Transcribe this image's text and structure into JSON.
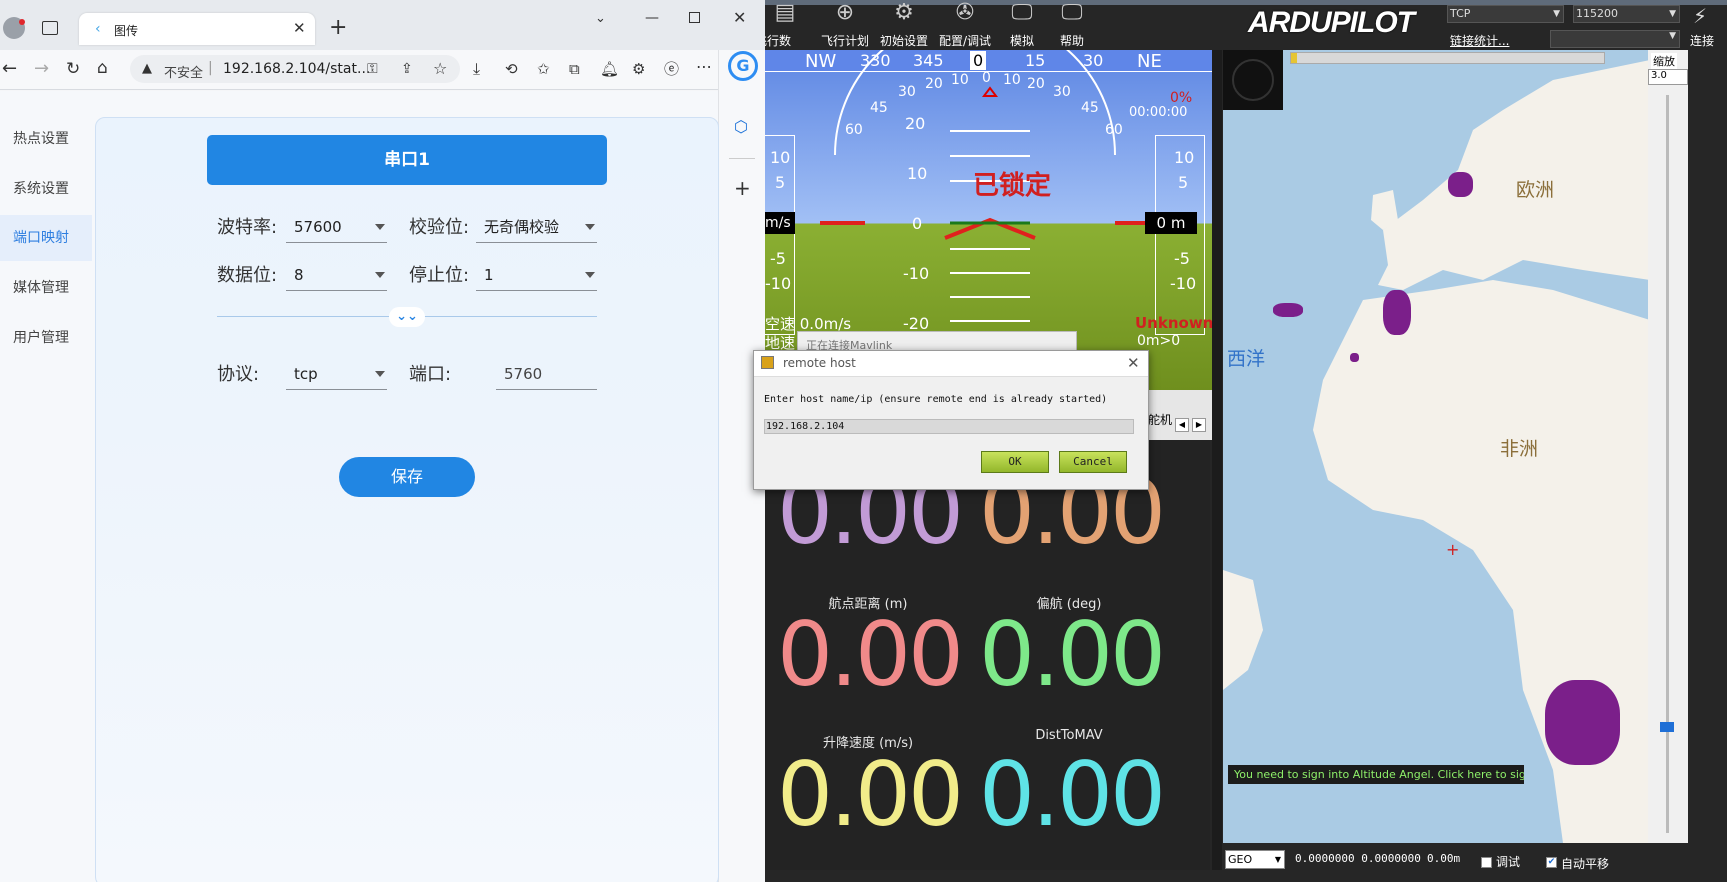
{
  "browser": {
    "tab_title": "图传",
    "security_label": "不安全",
    "url": "192.168.2.104/stat...",
    "sidebar": [
      {
        "label": "热点设置",
        "active": false
      },
      {
        "label": "系统设置",
        "active": false
      },
      {
        "label": "端口映射",
        "active": true
      },
      {
        "label": "媒体管理",
        "active": false
      },
      {
        "label": "用户管理",
        "active": false
      }
    ],
    "card": {
      "title": "串口1",
      "baud_label": "波特率:",
      "baud_value": "57600",
      "parity_label": "校验位:",
      "parity_value": "无奇偶校验",
      "databits_label": "数据位:",
      "databits_value": "8",
      "stopbits_label": "停止位:",
      "stopbits_value": "1",
      "protocol_label": "协议:",
      "protocol_value": "tcp",
      "port_label": "端口:",
      "port_value": "5760",
      "save_label": "保存"
    }
  },
  "mp": {
    "menu": [
      "飞行数据",
      "飞行计划",
      "初始设置",
      "配置/调试",
      "模拟",
      "帮助"
    ],
    "logo": "ARDUPILOT",
    "conn_type": "TCP",
    "baud": "115200",
    "link_stats": "链接统计...",
    "connect": "连接",
    "hud": {
      "heading_labels": [
        "NW",
        "330",
        "345",
        "0",
        "15",
        "30",
        "NE"
      ],
      "status": "已锁定",
      "airspeed": "空速 0.0m/s",
      "groundspeed": "地速",
      "connecting": "正在连接Mavlink",
      "unknown": "Unknown",
      "alt_text": "0m>0",
      "battery": "0%",
      "time": "00:00:00",
      "left_speed": "m/s",
      "right_alt": "0 m",
      "ladder": [
        "20",
        "10",
        "0",
        "-10",
        "-20"
      ],
      "roll_labels": [
        "60",
        "45",
        "30",
        "20",
        "10",
        "0",
        "10",
        "20",
        "30",
        "45",
        "60"
      ],
      "side_ticks": [
        "10",
        "5",
        "-5",
        "-10"
      ]
    },
    "tab_label": "舵机",
    "quick": [
      {
        "label": "",
        "value": "0.00",
        "color": "#c29bd6"
      },
      {
        "label": "",
        "value": "0.00",
        "color": "#e3a273"
      },
      {
        "label": "航点距离 (m)",
        "value": "0.00",
        "color": "#f08a8a"
      },
      {
        "label": "偏航 (deg)",
        "value": "0.00",
        "color": "#7ee88a"
      },
      {
        "label": "升降速度 (m/s)",
        "value": "0.00",
        "color": "#f1ec8a"
      },
      {
        "label": "DistToMAV",
        "value": "0.00",
        "color": "#5fe3e6"
      }
    ],
    "map": {
      "labels": {
        "europe": "欧洲",
        "africa": "非洲",
        "ocean": "西洋"
      },
      "sign_in": "You need to sign into Altitude Angel. Click here to sign in.",
      "zoom_label": "缩放",
      "zoom_value": "3.0",
      "geo": "GEO",
      "coords": "0.0000000 0.0000000",
      "alt": "0.00m",
      "debug": "调试",
      "autopan": "自动平移"
    },
    "dialog": {
      "title": "remote host",
      "prompt": "Enter host name/ip (ensure remote end is already started)",
      "value": "192.168.2.104",
      "ok": "OK",
      "cancel": "Cancel"
    }
  }
}
